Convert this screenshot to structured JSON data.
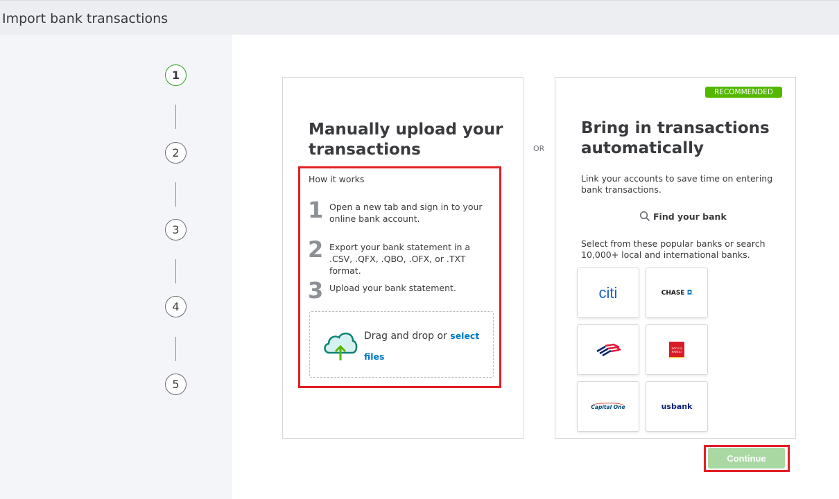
{
  "header": {
    "title": "Import bank transactions"
  },
  "steps": [
    "1",
    "2",
    "3",
    "4",
    "5"
  ],
  "manual": {
    "title": "Manually upload your transactions",
    "how_label": "How it works",
    "items": [
      {
        "num": "1",
        "text": "Open a new tab and sign in to your online bank account."
      },
      {
        "num": "2",
        "text": "Export your bank statement in a .CSV, .QFX, .QBO, .OFX, or .TXT format."
      },
      {
        "num": "3",
        "text": "Upload your bank statement."
      }
    ],
    "drop_text": "Drag and drop or ",
    "drop_link": "select files"
  },
  "or_label": "OR",
  "auto": {
    "badge": "RECOMMENDED",
    "title": "Bring in transactions automatically",
    "desc": "Link your accounts to save time on entering bank transactions.",
    "find_label": "Find your bank",
    "select_text": "Select from these popular banks or search 10,000+ local and international banks.",
    "banks": [
      "citi",
      "CHASE",
      "Bank of America",
      "WELLS FARGO",
      "Capital One",
      "usbank"
    ]
  },
  "continue_label": "Continue",
  "colors": {
    "accent": "#2ca01c",
    "badge": "#53b700",
    "continue_disabled": "#a9d8a2",
    "highlight": "#e31e24",
    "link": "#0077c5"
  }
}
